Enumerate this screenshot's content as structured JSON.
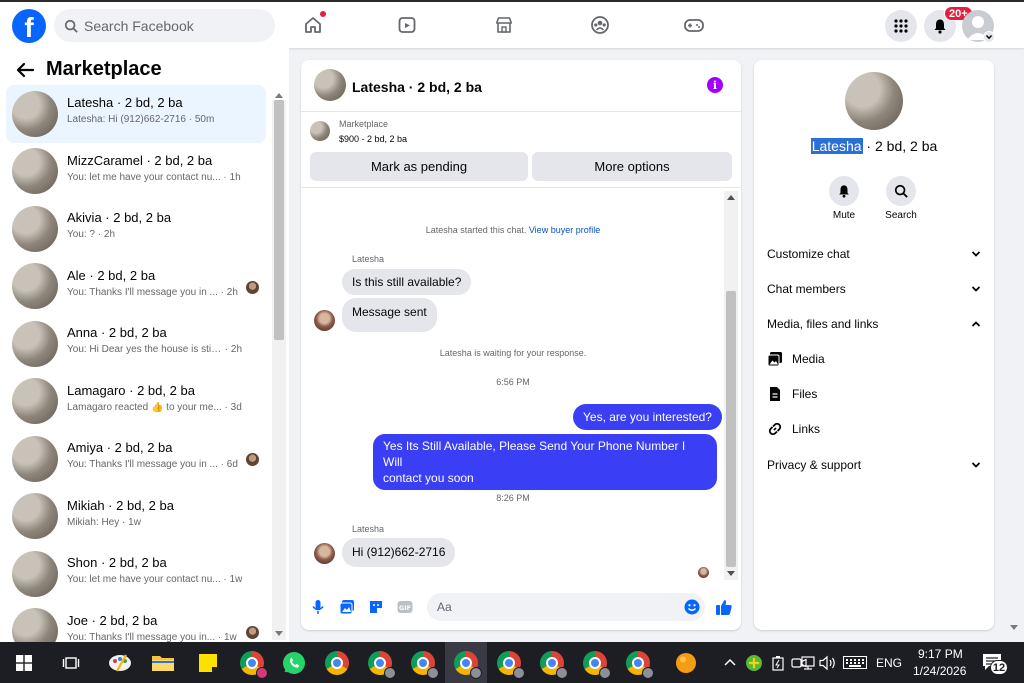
{
  "topbar": {
    "logo": "f",
    "search_placeholder": "Search Facebook",
    "notifications_badge": "20+"
  },
  "marketplace": {
    "title": "Marketplace",
    "conversations": [
      {
        "name": "Latesha · 2 bd, 2 ba",
        "preview": "Latesha: Hi (912)662-2716",
        "time": "· 50m",
        "active": true,
        "avatar": false
      },
      {
        "name": "MizzCaramel · 2 bd, 2 ba",
        "preview": "You: let me have your contact nu...",
        "time": "· 1h",
        "active": false,
        "avatar": false
      },
      {
        "name": "Akivia · 2 bd, 2 ba",
        "preview": "You: ?",
        "time": "· 2h",
        "active": false,
        "avatar": false
      },
      {
        "name": "Ale · 2 bd, 2 ba",
        "preview": "You: Thanks I'll message you in ...",
        "time": "· 2h",
        "active": false,
        "avatar": true
      },
      {
        "name": "Anna · 2 bd, 2 ba",
        "preview": "You: Hi Dear yes the house is still ...",
        "time": "· 2h",
        "active": false,
        "avatar": false
      },
      {
        "name": "Lamagaro · 2 bd, 2 ba",
        "preview": "Lamagaro reacted 👍 to your me...",
        "time": "· 3d",
        "active": false,
        "avatar": false
      },
      {
        "name": "Amiya · 2 bd, 2 ba",
        "preview": "You: Thanks I'll message you in ...",
        "time": "· 6d",
        "active": false,
        "avatar": true
      },
      {
        "name": "Mikiah · 2 bd, 2 ba",
        "preview": "Mikiah: Hey",
        "time": "· 1w",
        "active": false,
        "avatar": false
      },
      {
        "name": "Shon · 2 bd, 2 ba",
        "preview": "You: let me have your contact nu...",
        "time": "· 1w",
        "active": false,
        "avatar": false
      },
      {
        "name": "Joe · 2 bd, 2 ba",
        "preview": "You: Thanks I'll message you in...",
        "time": "· 1w",
        "active": false,
        "avatar": true
      }
    ]
  },
  "chat": {
    "title": "Latesha · 2 bd, 2 ba",
    "listing_source": "Marketplace",
    "listing_detail": "$900 - 2 bd, 2 ba",
    "mark_pending": "Mark as pending",
    "more_options": "More options",
    "started_text": "Latesha started this chat.",
    "view_profile": "View buyer profile",
    "sender_name_1": "Latesha",
    "msg_1": "Is this still available?",
    "msg_2": "Message sent",
    "waiting_text": "Latesha is waiting for your response.",
    "time_1": "6:56 PM",
    "msg_3": "Yes, are you interested?",
    "msg_4_line1": "Yes Its Still Available, Please Send Your Phone Number I Will",
    "msg_4_line2": "contact you soon",
    "time_2": "8:26 PM",
    "sender_name_2": "Latesha",
    "msg_5": "Hi (912)662-2716",
    "composer_placeholder": "Aa"
  },
  "details": {
    "name_highlight": "Latesha",
    "name_rest": " · 2 bd, 2 ba",
    "mute": "Mute",
    "search": "Search",
    "customize_chat": "Customize chat",
    "chat_members": "Chat members",
    "media_files_links": "Media, files and links",
    "media": "Media",
    "files": "Files",
    "links": "Links",
    "privacy_support": "Privacy & support"
  },
  "taskbar": {
    "language": "ENG",
    "time": "9:17 PM",
    "date": "1/24/2026",
    "notification_count": "12"
  },
  "colors": {
    "brand": "#0866ff",
    "outgoing_bubble": "#3a3ff5",
    "active_conversation": "#ebf5ff",
    "badge": "#e41e3f"
  }
}
